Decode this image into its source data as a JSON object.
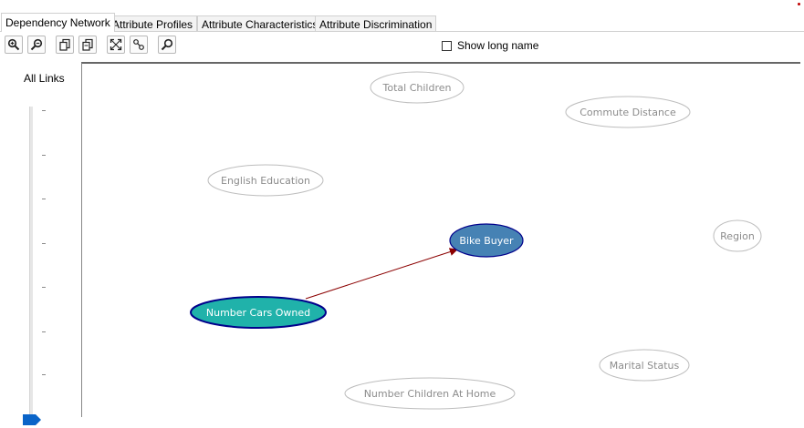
{
  "tabs": [
    {
      "label": "Dependency Network",
      "active": true
    },
    {
      "label": "Attribute Profiles",
      "active": false
    },
    {
      "label": "Attribute Characteristics",
      "active": false
    },
    {
      "label": "Attribute Discrimination",
      "active": false
    }
  ],
  "toolbar": {
    "buttons": [
      "zoom-in-icon",
      "zoom-out-icon",
      "copy-graph-icon",
      "copy-view-icon",
      "fit-to-window-icon",
      "layout-icon",
      "find-node-icon"
    ],
    "show_long_name_label": "Show long name",
    "show_long_name_checked": false
  },
  "sidebar": {
    "title": "All Links",
    "slider_level": 0.0
  },
  "colors": {
    "selected_node_fill": "#4682b4",
    "predictor_node_fill": "#20b2aa",
    "node_border_dark": "#00008b",
    "inactive_node_border": "#bdbdbd",
    "inactive_text": "#8c8c8c",
    "edge": "#8b0000"
  },
  "network": {
    "nodes": [
      {
        "id": "total-children",
        "label": "Total Children",
        "state": "inactive"
      },
      {
        "id": "commute-distance",
        "label": "Commute Distance",
        "state": "inactive"
      },
      {
        "id": "english-education",
        "label": "English Education",
        "state": "inactive"
      },
      {
        "id": "bike-buyer",
        "label": "Bike Buyer",
        "state": "selected"
      },
      {
        "id": "region",
        "label": "Region",
        "state": "inactive"
      },
      {
        "id": "number-cars-owned",
        "label": "Number Cars Owned",
        "state": "predictor"
      },
      {
        "id": "marital-status",
        "label": "Marital Status",
        "state": "inactive"
      },
      {
        "id": "number-children-at-home",
        "label": "Number Children At Home",
        "state": "inactive"
      }
    ],
    "edges": [
      {
        "from": "number-cars-owned",
        "to": "bike-buyer"
      }
    ]
  }
}
